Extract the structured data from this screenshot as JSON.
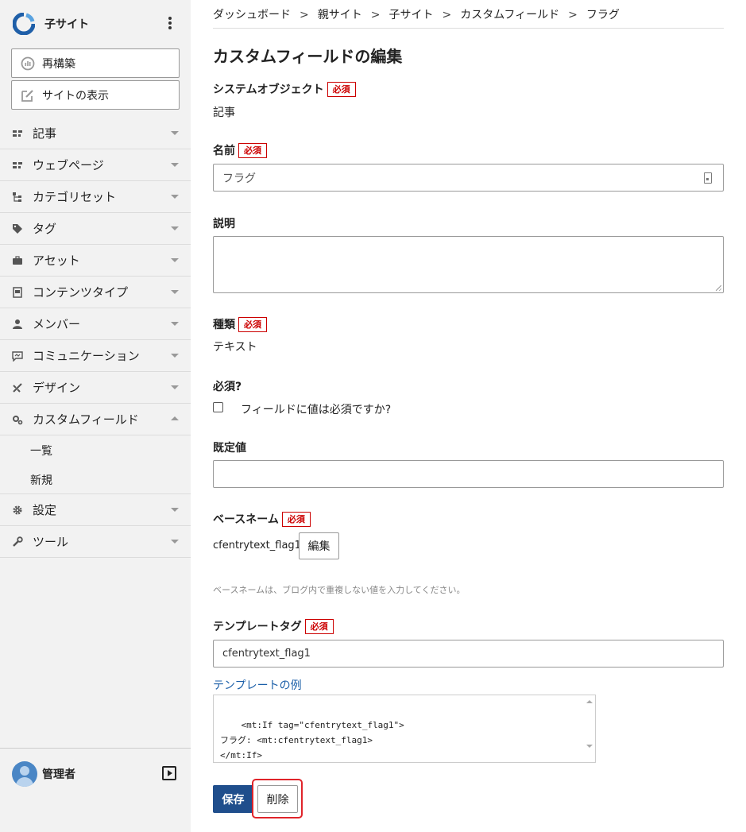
{
  "site": {
    "name": "子サイト",
    "logo_icon": "site-logo-icon",
    "more_icon": "kebab-icon"
  },
  "sidebar": {
    "rebuild_label": "再構築",
    "view_label": "サイトの表示",
    "menu": [
      {
        "label": "記事",
        "icon": "entries-icon",
        "expanded": false
      },
      {
        "label": "ウェブページ",
        "icon": "pages-icon",
        "expanded": false
      },
      {
        "label": "カテゴリセット",
        "icon": "category-icon",
        "expanded": false
      },
      {
        "label": "タグ",
        "icon": "tag-icon",
        "expanded": false
      },
      {
        "label": "アセット",
        "icon": "asset-icon",
        "expanded": false
      },
      {
        "label": "コンテンツタイプ",
        "icon": "content-type-icon",
        "expanded": false
      },
      {
        "label": "メンバー",
        "icon": "member-icon",
        "expanded": false
      },
      {
        "label": "コミュニケーション",
        "icon": "comment-icon",
        "expanded": false
      },
      {
        "label": "デザイン",
        "icon": "design-icon",
        "expanded": false
      },
      {
        "label": "カスタムフィールド",
        "icon": "custom-field-icon",
        "expanded": true
      },
      {
        "label": "設定",
        "icon": "gear-icon",
        "expanded": false
      },
      {
        "label": "ツール",
        "icon": "wrench-icon",
        "expanded": false
      }
    ],
    "submenu": [
      "一覧",
      "新規"
    ]
  },
  "user": {
    "name": "管理者"
  },
  "breadcrumb": [
    "ダッシュボード",
    "親サイト",
    "子サイト",
    "カスタムフィールド",
    "フラグ"
  ],
  "breadcrumb_sep": ">",
  "page_title": "カスタムフィールドの編集",
  "required_badge": "必須",
  "form": {
    "system_object_label": "システムオブジェクト",
    "system_object_value": "記事",
    "name_label": "名前",
    "name_value": "フラグ",
    "description_label": "説明",
    "description_value": "",
    "type_label": "種類",
    "type_value": "テキスト",
    "required_label": "必須?",
    "required_checkbox_label": "フィールドに値は必須ですか?",
    "required_checked": false,
    "default_label": "既定値",
    "default_value": "",
    "basename_label": "ベースネーム",
    "basename_value": "cfentrytext_flag1",
    "basename_edit": "編集",
    "basename_hint": "ベースネームは、ブログ内で重複しない値を入力してください。",
    "template_tag_label": "テンプレートタグ",
    "template_tag_value": "cfentrytext_flag1",
    "template_example_link": "テンプレートの例",
    "template_example_code": "<mt:If tag=\"cfentrytext_flag1\">\nフラグ: <mt:cfentrytext_flag1>\n</mt:If>"
  },
  "actions": {
    "save": "保存",
    "delete": "削除"
  },
  "colors": {
    "primary": "#1f4e8c",
    "required": "#cc0000",
    "highlight": "#e0242a",
    "link": "#1a5ea8"
  }
}
